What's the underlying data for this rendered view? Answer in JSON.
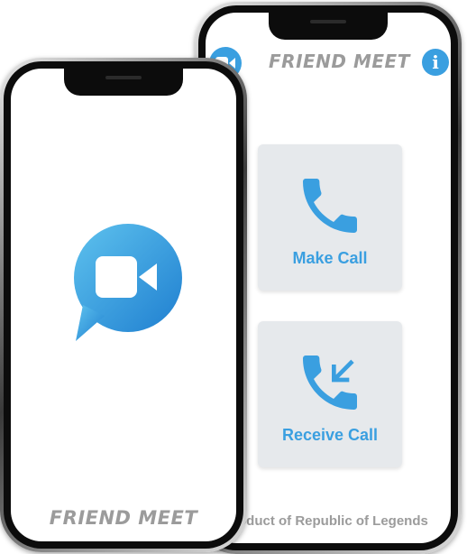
{
  "splash": {
    "title": "FRIEND MEET",
    "logo_icon": "video-chat-bubble-icon"
  },
  "app": {
    "header": {
      "title": "FRIEND MEET",
      "left_icon": "video-camera-icon",
      "right_icon": "info-icon",
      "info_glyph": "i"
    },
    "cards": [
      {
        "label": "Make Call",
        "icon": "phone-icon"
      },
      {
        "label": "Receive Call",
        "icon": "phone-incoming-icon"
      }
    ],
    "footer": "oduct of Republic of Legends"
  },
  "colors": {
    "accent": "#3a9fe0",
    "title_gray": "#9b9b9b",
    "card_bg": "#e6e9ec"
  }
}
